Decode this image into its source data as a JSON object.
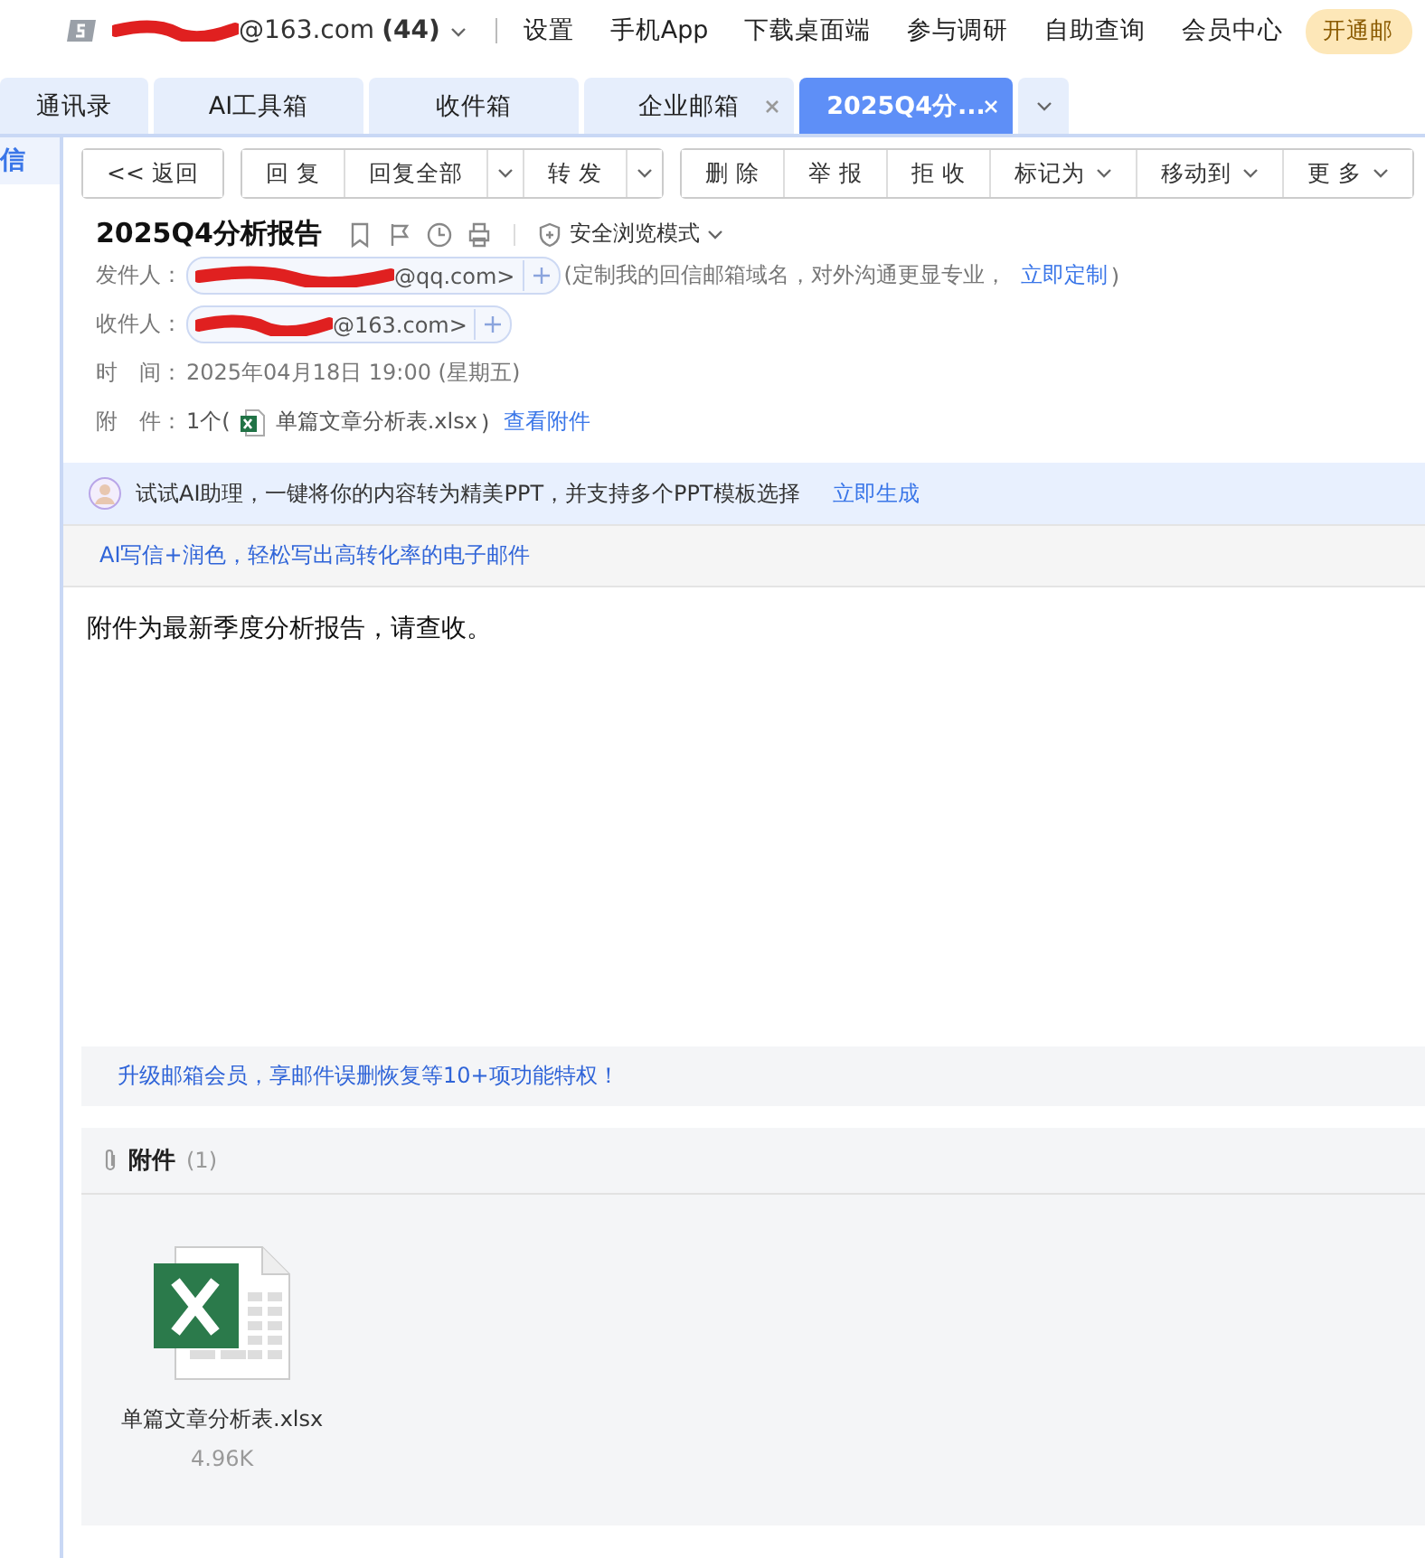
{
  "top_bar": {
    "account": "@163.com",
    "unread": "(44)",
    "links": [
      "设置",
      "手机App",
      "下载桌面端",
      "参与调研",
      "自助查询",
      "会员中心"
    ],
    "vip_button": "开通邮"
  },
  "tabs": [
    {
      "label": "通讯录",
      "selected": false,
      "closable": false
    },
    {
      "label": "AI工具箱",
      "selected": false,
      "closable": false
    },
    {
      "label": "收件箱",
      "selected": false,
      "closable": false
    },
    {
      "label": "企业邮箱",
      "selected": false,
      "closable": true
    },
    {
      "label": "2025Q4分...",
      "selected": true,
      "closable": true
    }
  ],
  "sidebar": {
    "items": [
      {
        "label": "信",
        "selected": true
      }
    ]
  },
  "toolbar": {
    "groups": [
      [
        {
          "kind": "button",
          "label": "<< 返回"
        }
      ],
      [
        {
          "kind": "button",
          "label": "回 复"
        },
        {
          "kind": "button",
          "label": "回复全部"
        },
        {
          "kind": "split"
        },
        {
          "kind": "button",
          "label": "转 发"
        },
        {
          "kind": "split"
        }
      ],
      [
        {
          "kind": "button",
          "label": "删 除"
        },
        {
          "kind": "button",
          "label": "举 报"
        },
        {
          "kind": "button",
          "label": "拒 收"
        },
        {
          "kind": "menu",
          "label": "标记为"
        },
        {
          "kind": "menu",
          "label": "移动到"
        },
        {
          "kind": "menu",
          "label": "更 多"
        }
      ]
    ]
  },
  "mail": {
    "subject": "2025Q4分析报告",
    "safe_mode": "安全浏览模式",
    "from_label": "发件人：",
    "from": "@qq.com>",
    "from_note": "(定制我的回信邮箱域名，对外沟通更显专业，",
    "from_link": "立即定制",
    "from_note_end": ")",
    "to_label": "收件人：",
    "to": "@163.com>",
    "time_label": "时　间：",
    "time": "2025年04月18日 19:00 (星期五)",
    "attach_label": "附　件：",
    "attach_count": "1个(",
    "attach_name": "单篇文章分析表.xlsx",
    "attach_end": ")",
    "attach_link": "查看附件"
  },
  "ai_banner": {
    "text": "试试AI助理，一键将你的内容转为精美PPT，并支持多个PPT模板选择",
    "link": "立即生成"
  },
  "ai_write": "AI写信+润色，轻松写出高转化率的电子邮件",
  "body": "附件为最新季度分析报告，请查收。",
  "upgrade": "升级邮箱会员，享邮件误删恢复等10+项功能特权！",
  "attachments": {
    "title": "附件",
    "count": "(1)",
    "files": [
      {
        "name": "单篇文章分析表.xlsx",
        "size": "4.96K"
      }
    ]
  }
}
